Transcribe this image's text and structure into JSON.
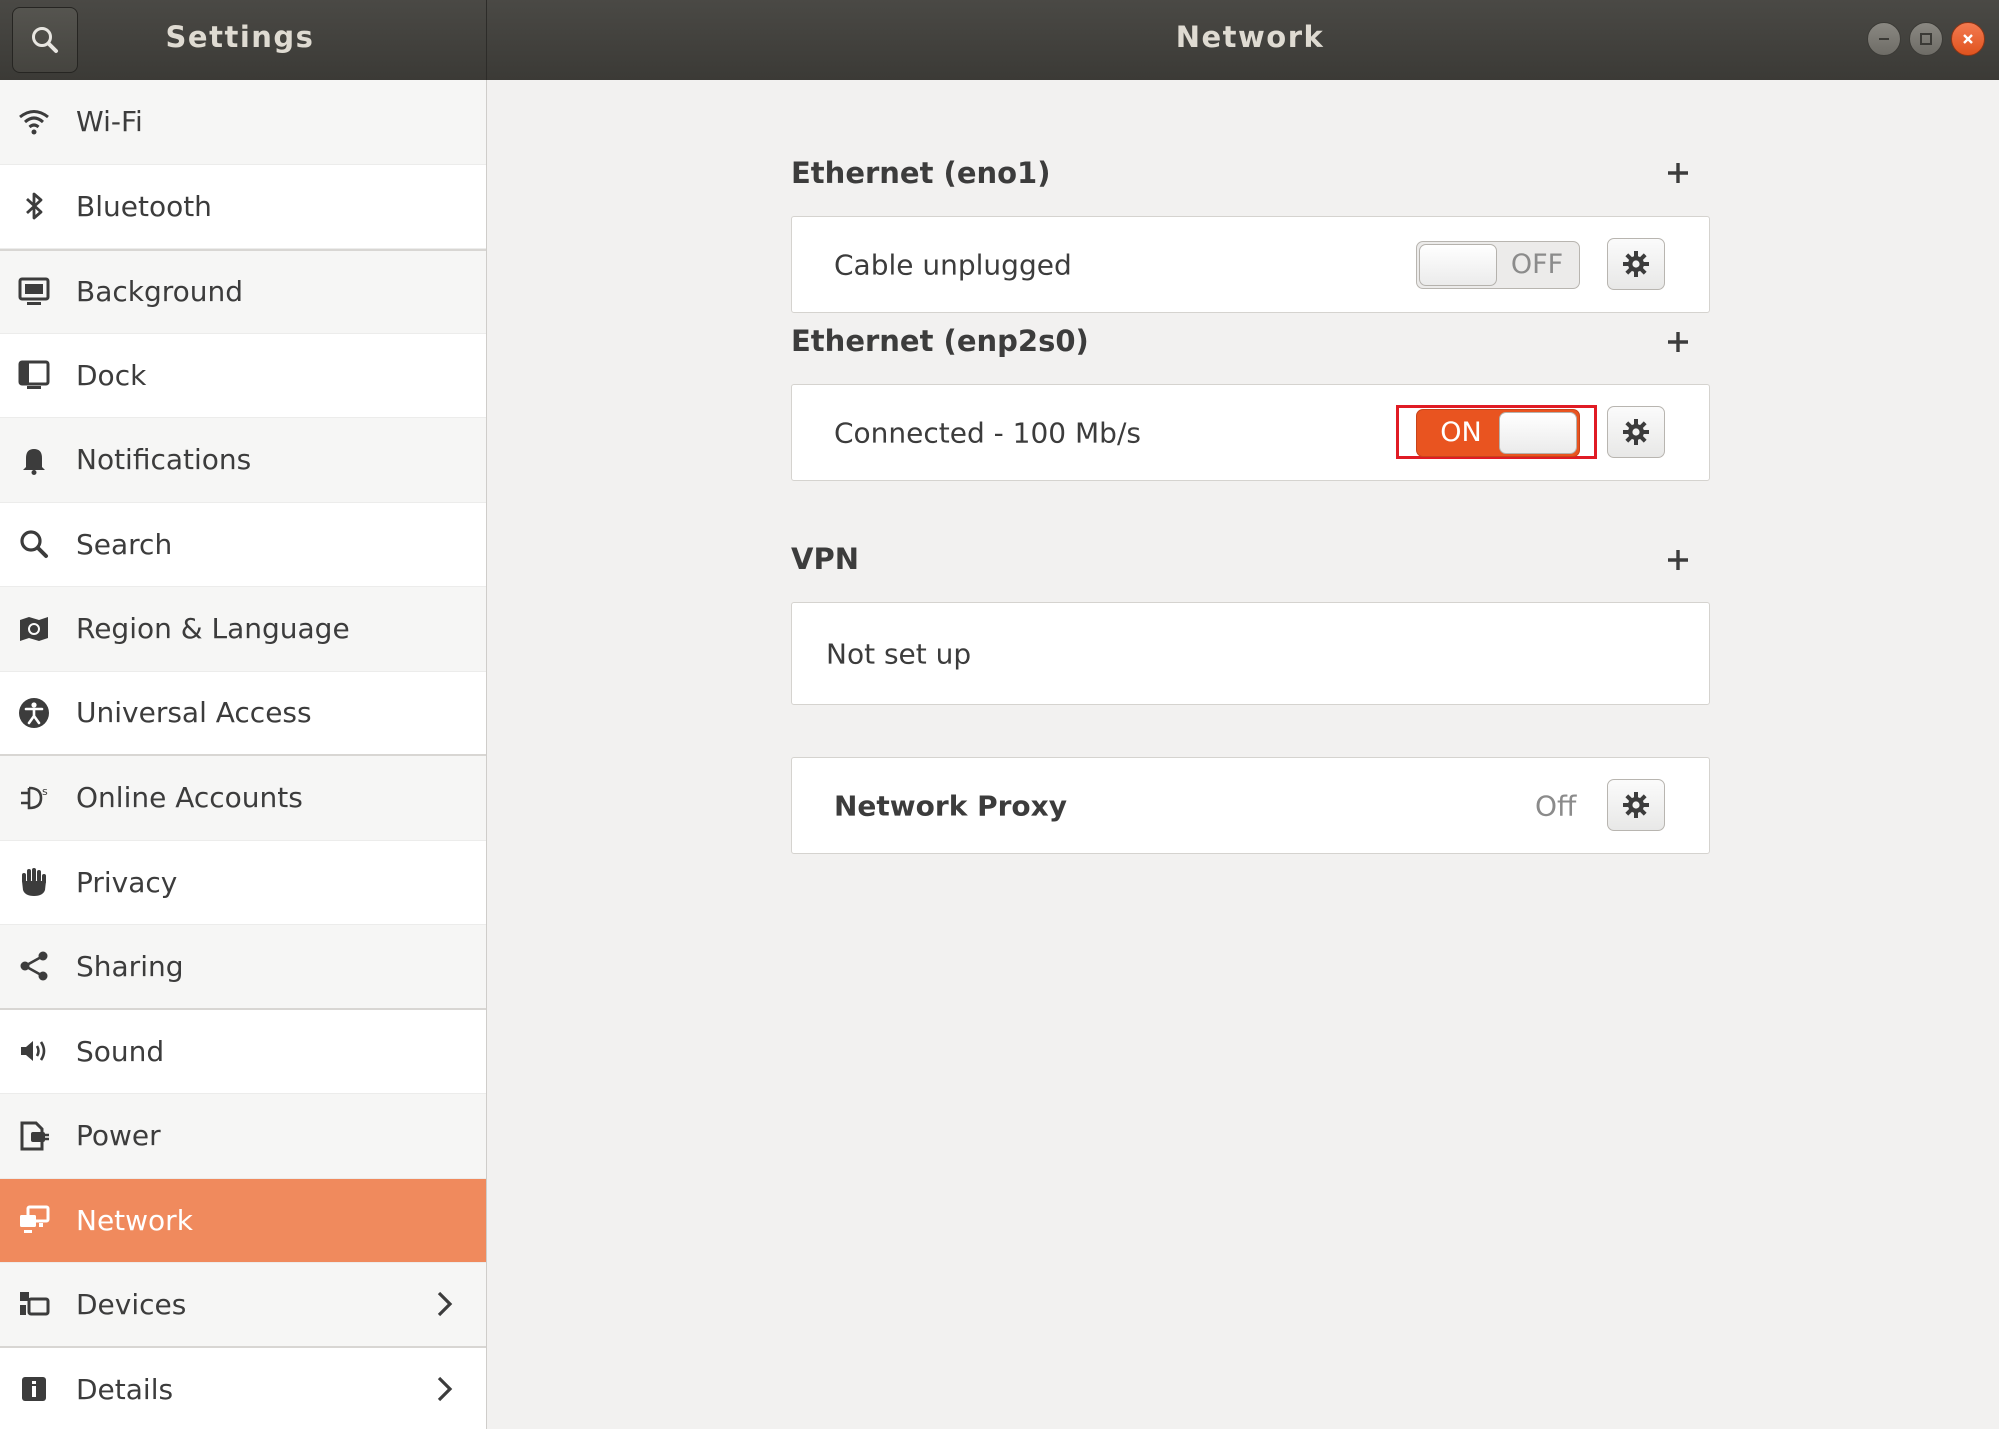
{
  "header": {
    "search_icon": "search-icon",
    "app_title": "Settings",
    "window_title": "Network"
  },
  "window_controls": [
    "minimize-icon",
    "maximize-icon",
    "close-icon"
  ],
  "sidebar": {
    "items": [
      {
        "label": "Wi-Fi",
        "icon": "wifi-icon"
      },
      {
        "label": "Bluetooth",
        "icon": "bluetooth-icon"
      },
      {
        "label": "Background",
        "icon": "background-icon"
      },
      {
        "label": "Dock",
        "icon": "dock-icon"
      },
      {
        "label": "Notifications",
        "icon": "bell-icon"
      },
      {
        "label": "Search",
        "icon": "search-icon"
      },
      {
        "label": "Region & Language",
        "icon": "region-icon"
      },
      {
        "label": "Universal Access",
        "icon": "accessibility-icon"
      },
      {
        "label": "Online Accounts",
        "icon": "online-accounts-icon"
      },
      {
        "label": "Privacy",
        "icon": "hand-icon"
      },
      {
        "label": "Sharing",
        "icon": "share-icon"
      },
      {
        "label": "Sound",
        "icon": "speaker-icon"
      },
      {
        "label": "Power",
        "icon": "power-icon"
      },
      {
        "label": "Network",
        "icon": "network-icon",
        "active": true
      },
      {
        "label": "Devices",
        "icon": "devices-icon",
        "chevron": true
      },
      {
        "label": "Details",
        "icon": "info-icon",
        "chevron": true
      }
    ]
  },
  "main": {
    "ethernet_eno1": {
      "title": "Ethernet (eno1)",
      "status": "Cable unplugged",
      "toggle": "OFF"
    },
    "ethernet_enp2s0": {
      "title": "Ethernet (enp2s0)",
      "status": "Connected - 100 Mb/s",
      "toggle": "ON"
    },
    "vpn": {
      "title": "VPN",
      "status": "Not set up"
    },
    "proxy": {
      "title": "Network Proxy",
      "status": "Off"
    }
  },
  "colors": {
    "accent": "#e95420",
    "sidebar_active": "#f08a5d",
    "highlight": "#e01b24",
    "headerbar": "#3b3a36"
  }
}
